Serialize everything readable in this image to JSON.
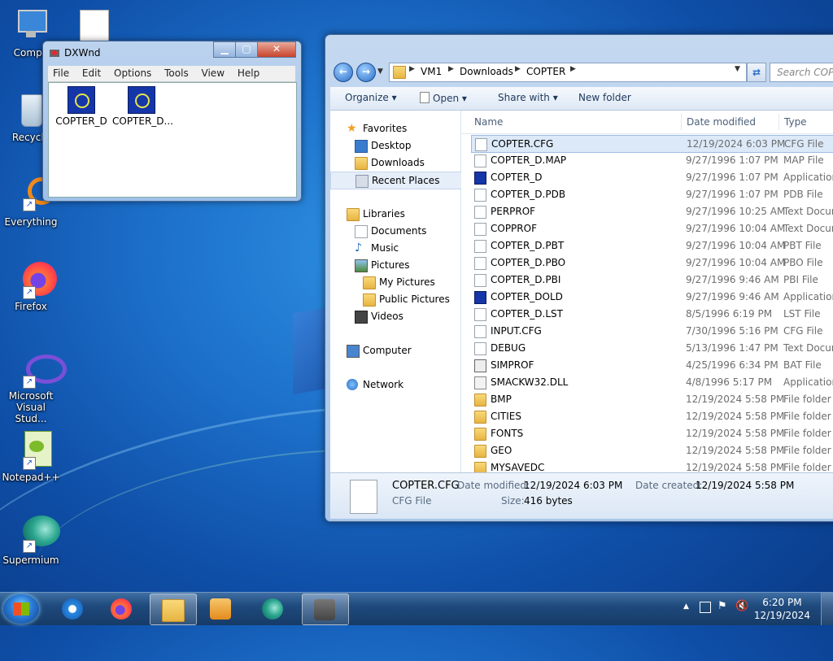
{
  "desktop": {
    "icons": [
      {
        "label": "Compu"
      },
      {
        "label": "Recycle"
      },
      {
        "label": "Everything"
      },
      {
        "label": "Firefox"
      },
      {
        "label": "Microsoft Visual Stud..."
      },
      {
        "label": "Notepad++"
      },
      {
        "label": "Supermium"
      }
    ]
  },
  "dxwnd": {
    "title": "DXWnd",
    "menu": [
      "File",
      "Edit",
      "Options",
      "Tools",
      "View",
      "Help"
    ],
    "items": [
      "COPTER_D",
      "COPTER_D..."
    ],
    "buttons": {
      "minimize": "▁",
      "maximize": "▢",
      "close": "✕"
    }
  },
  "explorer": {
    "breadcrumb": [
      "VM1",
      "Downloads",
      "COPTER"
    ],
    "search_placeholder": "Search COPT",
    "commands": {
      "organize": "Organize",
      "open": "Open",
      "share": "Share with",
      "new_folder": "New folder"
    },
    "nav": {
      "favorites": "Favorites",
      "desktop": "Desktop",
      "downloads": "Downloads",
      "recent": "Recent Places",
      "libraries": "Libraries",
      "documents": "Documents",
      "music": "Music",
      "pictures": "Pictures",
      "my_pictures": "My Pictures",
      "public_pictures": "Public Pictures",
      "videos": "Videos",
      "computer": "Computer",
      "network": "Network"
    },
    "columns": {
      "name": "Name",
      "date": "Date modified",
      "type": "Type"
    },
    "files": [
      {
        "name": "COPTER.CFG",
        "date": "12/19/2024 6:03 PM",
        "type": "CFG File",
        "icon": "file"
      },
      {
        "name": "COPTER_D.MAP",
        "date": "9/27/1996 1:07 PM",
        "type": "MAP File",
        "icon": "file"
      },
      {
        "name": "COPTER_D",
        "date": "9/27/1996 1:07 PM",
        "type": "Application",
        "icon": "app"
      },
      {
        "name": "COPTER_D.PDB",
        "date": "9/27/1996 1:07 PM",
        "type": "PDB File",
        "icon": "file"
      },
      {
        "name": "PERPROF",
        "date": "9/27/1996 10:25 AM",
        "type": "Text Docum",
        "icon": "file"
      },
      {
        "name": "COPPROF",
        "date": "9/27/1996 10:04 AM",
        "type": "Text Docum",
        "icon": "file"
      },
      {
        "name": "COPTER_D.PBT",
        "date": "9/27/1996 10:04 AM",
        "type": "PBT File",
        "icon": "file"
      },
      {
        "name": "COPTER_D.PBO",
        "date": "9/27/1996 10:04 AM",
        "type": "PBO File",
        "icon": "file"
      },
      {
        "name": "COPTER_D.PBI",
        "date": "9/27/1996 9:46 AM",
        "type": "PBI File",
        "icon": "file"
      },
      {
        "name": "COPTER_DOLD",
        "date": "9/27/1996 9:46 AM",
        "type": "Application",
        "icon": "app"
      },
      {
        "name": "COPTER_D.LST",
        "date": "8/5/1996 6:19 PM",
        "type": "LST File",
        "icon": "file"
      },
      {
        "name": "INPUT.CFG",
        "date": "7/30/1996 5:16 PM",
        "type": "CFG File",
        "icon": "file"
      },
      {
        "name": "DEBUG",
        "date": "5/13/1996 1:47 PM",
        "type": "Text Docum",
        "icon": "file"
      },
      {
        "name": "SIMPROF",
        "date": "4/25/1996 6:34 PM",
        "type": "BAT File",
        "icon": "bat"
      },
      {
        "name": "SMACKW32.DLL",
        "date": "4/8/1996 5:17 PM",
        "type": "Application",
        "icon": "dll"
      },
      {
        "name": "BMP",
        "date": "12/19/2024 5:58 PM",
        "type": "File folder",
        "icon": "folder"
      },
      {
        "name": "CITIES",
        "date": "12/19/2024 5:58 PM",
        "type": "File folder",
        "icon": "folder"
      },
      {
        "name": "FONTS",
        "date": "12/19/2024 5:58 PM",
        "type": "File folder",
        "icon": "folder"
      },
      {
        "name": "GEO",
        "date": "12/19/2024 5:58 PM",
        "type": "File folder",
        "icon": "folder"
      },
      {
        "name": "MYSAVEDC",
        "date": "12/19/2024 5:58 PM",
        "type": "File folder",
        "icon": "folder"
      }
    ],
    "details": {
      "name": "COPTER.CFG",
      "type": "CFG File",
      "modified_label": "Date modified:",
      "modified": "12/19/2024 6:03 PM",
      "created_label": "Date created:",
      "created": "12/19/2024 5:58 PM",
      "size_label": "Size:",
      "size": "416 bytes"
    }
  },
  "taskbar": {
    "time": "6:20 PM",
    "date": "12/19/2024"
  },
  "colors": {
    "selection": "#dce9f8",
    "taskbar": "#1f4a7d",
    "folder": "#e7b442"
  }
}
